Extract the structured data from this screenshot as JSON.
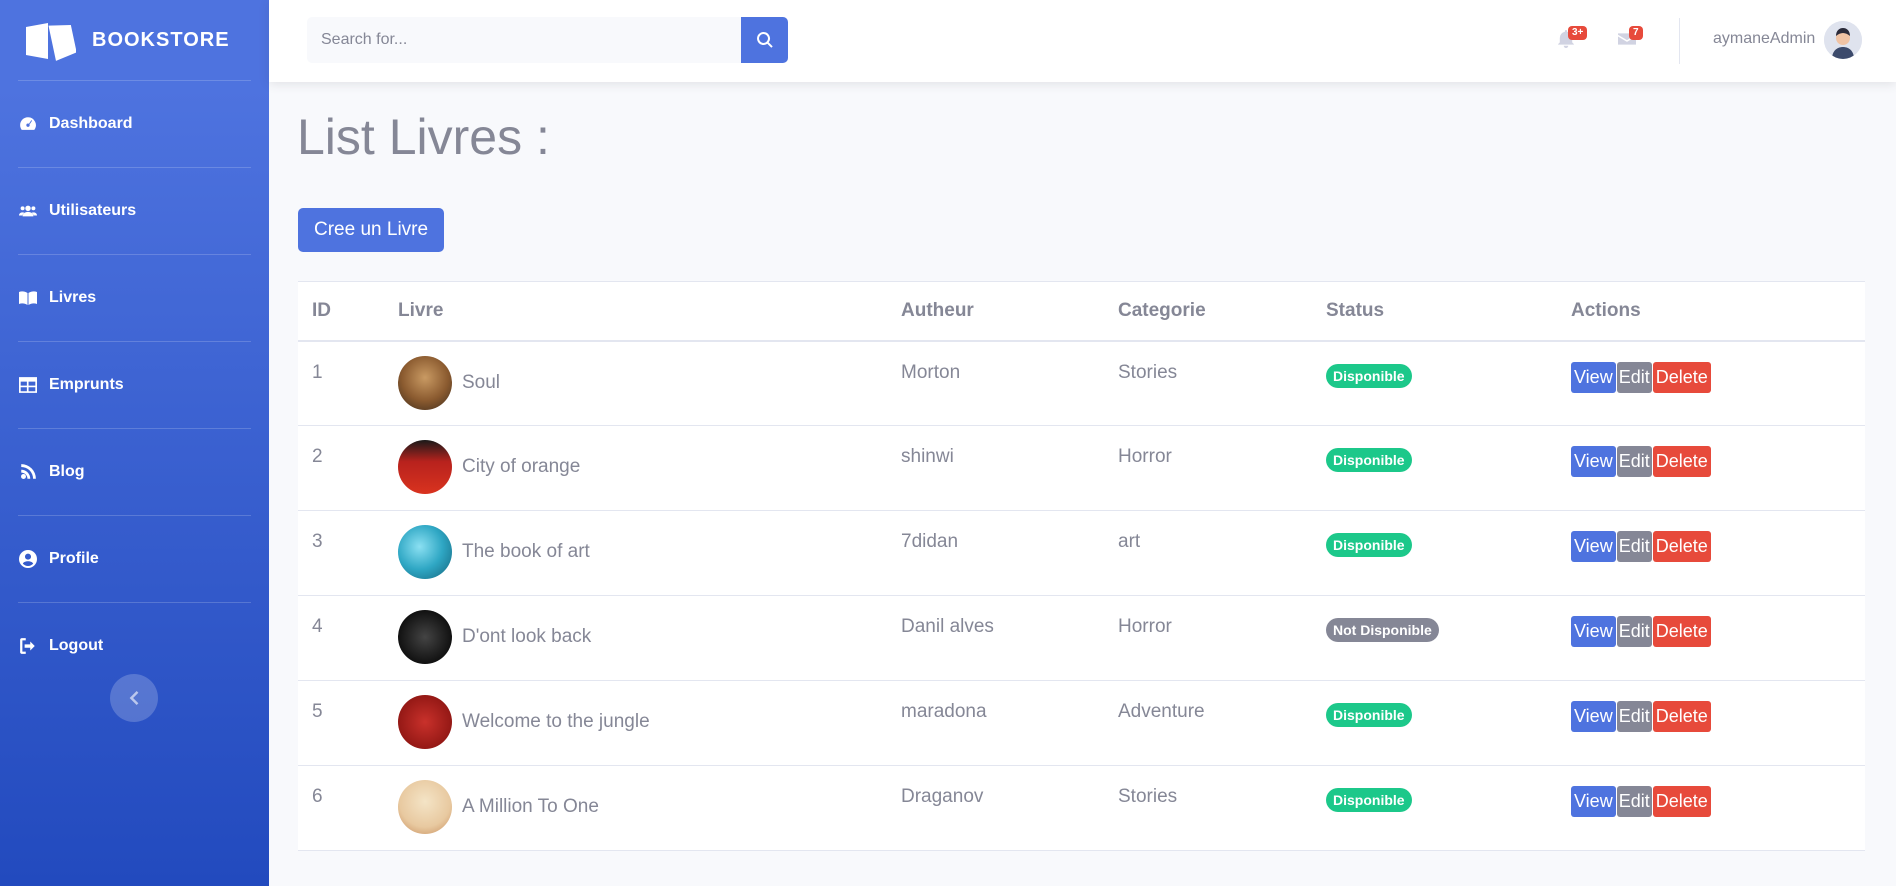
{
  "brand": {
    "name": "BOOKSTORE",
    "icon": "book-open-icon"
  },
  "sidebar": {
    "items": [
      {
        "label": "Dashboard",
        "icon": "tachometer-icon"
      },
      {
        "label": "Utilisateurs",
        "icon": "users-icon"
      },
      {
        "label": "Livres",
        "icon": "book-icon"
      },
      {
        "label": "Emprunts",
        "icon": "table-icon"
      },
      {
        "label": "Blog",
        "icon": "blog-icon"
      },
      {
        "label": "Profile",
        "icon": "user-circle-icon"
      },
      {
        "label": "Logout",
        "icon": "sign-out-icon"
      }
    ],
    "toggle_icon": "chevron-left-icon"
  },
  "topbar": {
    "search_placeholder": "Search for...",
    "alerts_badge": "3+",
    "messages_badge": "7",
    "user_name": "aymaneAdmin"
  },
  "page": {
    "title": "List Livres :",
    "create_button": "Cree un Livre"
  },
  "table": {
    "headers": [
      "ID",
      "Livre",
      "Autheur",
      "Categorie",
      "Status",
      "Actions"
    ],
    "actions": {
      "view": "View",
      "edit": "Edit",
      "delete": "Delete"
    },
    "rows": [
      {
        "id": "1",
        "title": "Soul",
        "author": "Morton",
        "category": "Stories",
        "status": "Disponible",
        "available": true
      },
      {
        "id": "2",
        "title": "City of orange",
        "author": "shinwi",
        "category": "Horror",
        "status": "Disponible",
        "available": true
      },
      {
        "id": "3",
        "title": "The book of art",
        "author": "7didan",
        "category": "art",
        "status": "Disponible",
        "available": true
      },
      {
        "id": "4",
        "title": "D'ont look back",
        "author": "Danil alves",
        "category": "Horror",
        "status": "Not Disponible",
        "available": false
      },
      {
        "id": "5",
        "title": "Welcome to the jungle",
        "author": "maradona",
        "category": "Adventure",
        "status": "Disponible",
        "available": true
      },
      {
        "id": "6",
        "title": "A Million To One",
        "author": "Draganov",
        "category": "Stories",
        "status": "Disponible",
        "available": true
      }
    ]
  },
  "colors": {
    "primary": "#4e73df",
    "success": "#1cc88a",
    "secondary": "#858796",
    "danger": "#e74a3b"
  }
}
